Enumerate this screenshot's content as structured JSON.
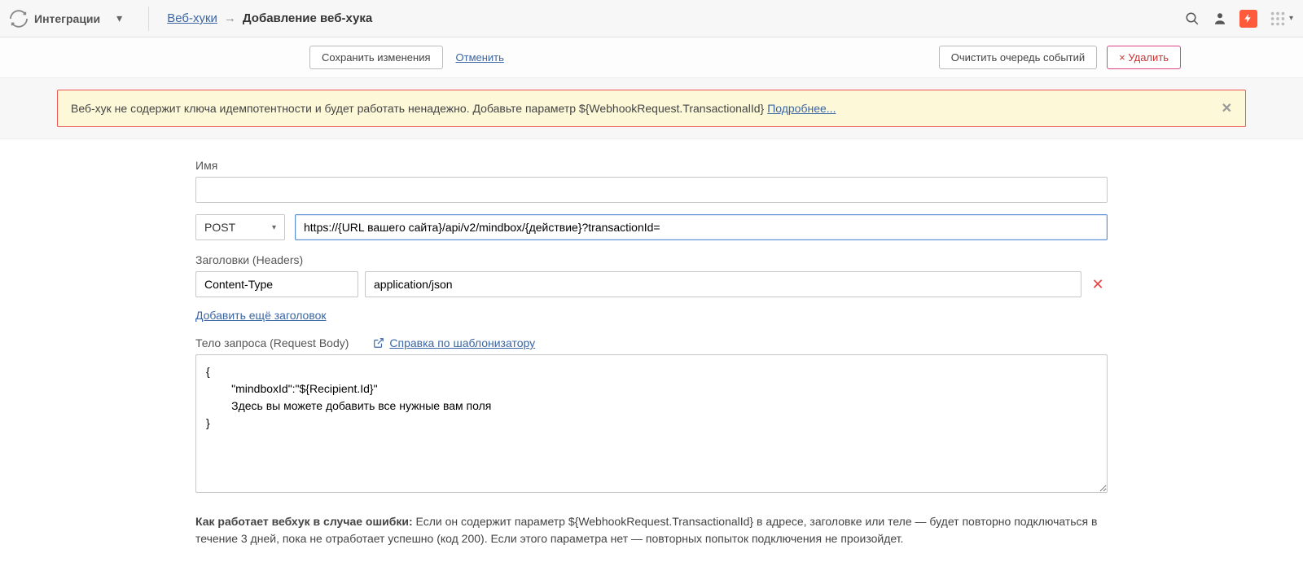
{
  "topbar": {
    "brand": "Интеграции",
    "breadcrumb_link": "Веб-хуки",
    "breadcrumb_arrow": "→",
    "breadcrumb_current": "Добавление веб-хука"
  },
  "actionbar": {
    "save": "Сохранить изменения",
    "cancel": "Отменить",
    "clear_queue": "Очистить очередь событий",
    "delete": "Удалить"
  },
  "alert": {
    "text": "Веб-хук не содержит ключа идемпотентности и будет работать ненадежно. Добавьте параметр ${WebhookRequest.TransactionalId} ",
    "more": "Подробнее..."
  },
  "form": {
    "name_label": "Имя",
    "name_value": "",
    "method": "POST",
    "url": "https://{URL вашего сайта}/api/v2/mindbox/{действие}?transactionId=",
    "headers_label": "Заголовки (Headers)",
    "header_name": "Content-Type",
    "header_value": "application/json",
    "add_header": "Добавить ещё заголовок",
    "body_label": "Тело запроса (Request Body)",
    "template_help": "Справка по шаблонизатору",
    "body_value": "{\n        \"mindboxId\":\"${Recipient.Id}\"\n        Здесь вы можете добавить все нужные вам поля\n}",
    "help_bold": "Как работает вебхук в случае ошибки:",
    "help_rest": "  Если он содержит параметр ${WebhookRequest.TransactionalId} в адресе, заголовке или теле — будет повторно подключаться в течение 3 дней, пока не отработает успешно (код 200). Если этого параметра нет — повторных попыток подключения не произойдет."
  }
}
